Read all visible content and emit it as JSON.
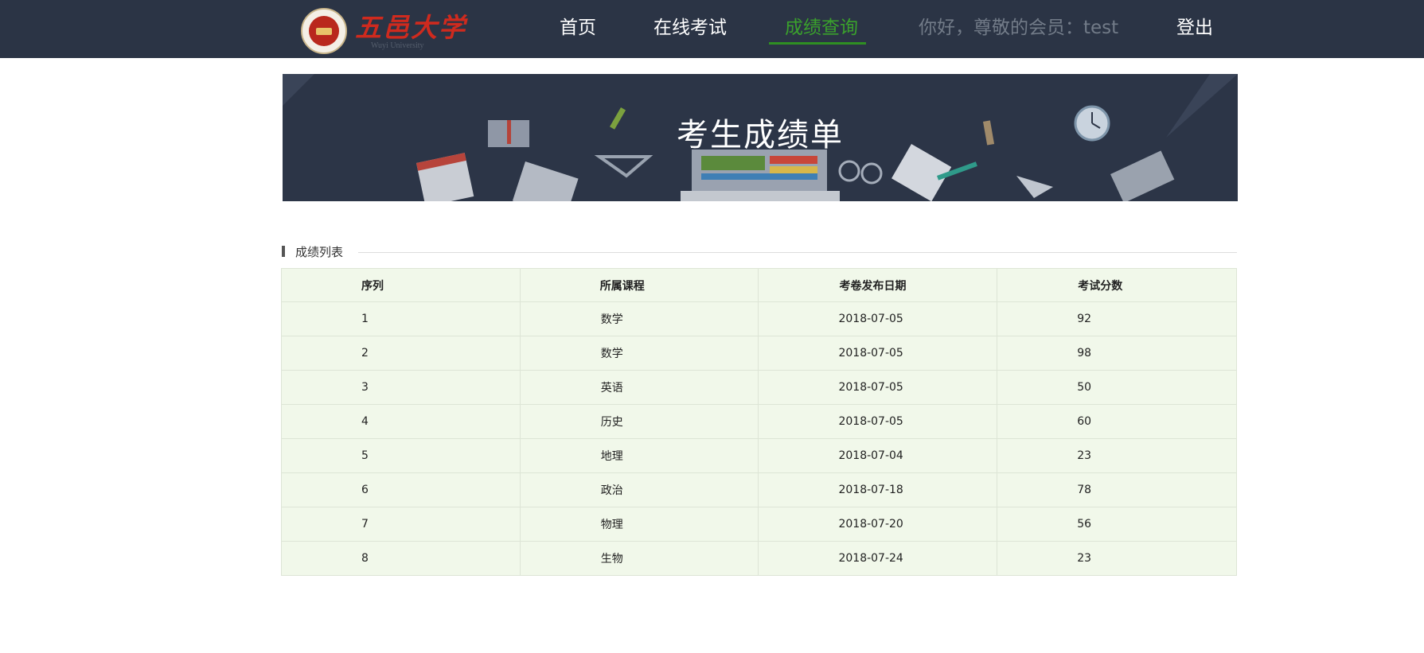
{
  "header": {
    "logo": {
      "name": "五邑大学",
      "subtitle": "Wuyi University"
    },
    "nav": {
      "home": "首页",
      "online_exam": "在线考试",
      "score_query": "成绩查询",
      "greeting": "你好，尊敬的会员：test",
      "logout": "登出"
    },
    "active_color": "#3aa12c"
  },
  "banner": {
    "title": "考生成绩单"
  },
  "section": {
    "title": "成绩列表"
  },
  "table": {
    "columns": [
      "序列",
      "所属课程",
      "考卷发布日期",
      "考试分数"
    ],
    "rows": [
      [
        "1",
        "数学",
        "2018-07-05",
        "92"
      ],
      [
        "2",
        "数学",
        "2018-07-05",
        "98"
      ],
      [
        "3",
        "英语",
        "2018-07-05",
        "50"
      ],
      [
        "4",
        "历史",
        "2018-07-05",
        "60"
      ],
      [
        "5",
        "地理",
        "2018-07-04",
        "23"
      ],
      [
        "6",
        "政治",
        "2018-07-18",
        "78"
      ],
      [
        "7",
        "物理",
        "2018-07-20",
        "56"
      ],
      [
        "8",
        "生物",
        "2018-07-24",
        "23"
      ]
    ]
  },
  "colors": {
    "topbar": "#2b3445",
    "banner": "#2c3547",
    "table_bg": "#f1f8ea"
  }
}
